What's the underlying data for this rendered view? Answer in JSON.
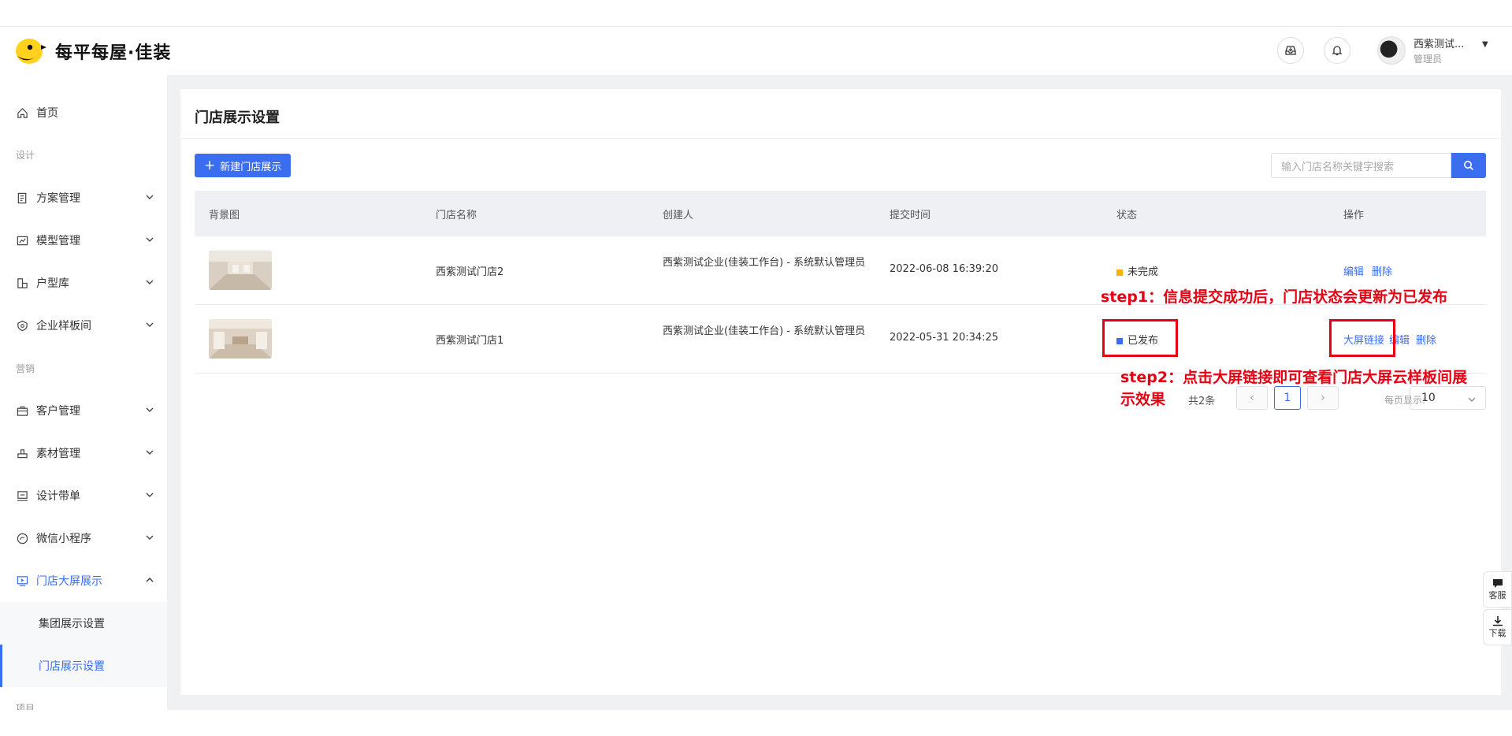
{
  "header": {
    "logo_text": "每平每屋·佳装",
    "user_name": "西紫测试...",
    "user_role": "管理员"
  },
  "sidebar": {
    "home": "首页",
    "section_design": "设计",
    "items": [
      {
        "label": "方案管理"
      },
      {
        "label": "模型管理"
      },
      {
        "label": "户型库"
      },
      {
        "label": "企业样板间"
      }
    ],
    "section_marketing": "营销",
    "items2": [
      {
        "label": "客户管理"
      },
      {
        "label": "素材管理"
      },
      {
        "label": "设计带单"
      },
      {
        "label": "微信小程序"
      },
      {
        "label": "门店大屏展示"
      }
    ],
    "sub_items": [
      {
        "label": "集团展示设置"
      },
      {
        "label": "门店展示设置"
      }
    ],
    "section_project": "项目"
  },
  "main": {
    "title": "门店展示设置",
    "new_button": "新建门店展示",
    "search_placeholder": "输入门店名称关键字搜索",
    "columns": [
      "背景图",
      "门店名称",
      "创建人",
      "提交时间",
      "状态",
      "操作"
    ],
    "rows": [
      {
        "store": "西紫测试门店2",
        "creator": "西紫测试企业(佳装工作台) - 系统默认管理员",
        "time": "2022-06-08 16:39:20",
        "status": "未完成",
        "status_color": "#f5b300",
        "actions": [
          "编辑",
          "删除"
        ]
      },
      {
        "store": "西紫测试门店1",
        "creator": "西紫测试企业(佳装工作台) - 系统默认管理员",
        "time": "2022-05-31 20:34:25",
        "status": "已发布",
        "status_color": "#3a6df0",
        "actions": [
          "大屏链接",
          "编辑",
          "删除"
        ]
      }
    ],
    "pagination": {
      "total": "共2条",
      "current": "1",
      "per_page_label": "每页显示:",
      "per_page": "10"
    }
  },
  "annotations": {
    "step1": "step1：信息提交成功后，门店状态会更新为已发布",
    "step2_line1": "step2：点击大屏链接即可查看门店大屏云样板间展",
    "step2_line2": "示效果"
  },
  "float_tools": {
    "service": "客服",
    "download": "下载"
  },
  "colors": {
    "accent": "#3a6df0",
    "annotation": "#e60012"
  }
}
